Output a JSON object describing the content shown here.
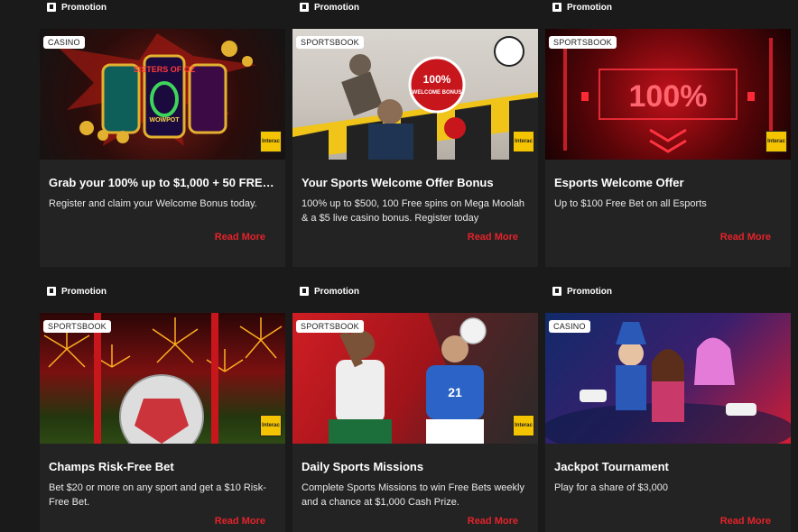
{
  "promo_label": "Promotion",
  "read_more": "Read More",
  "interac_label": "Interac",
  "cards": [
    {
      "tag": "CASINO",
      "title": "Grab your 100% up to $1,000 + 50 FREE ...",
      "desc": "Register and claim your Welcome Bonus today."
    },
    {
      "tag": "SPORTSBOOK",
      "title": "Your Sports Welcome Offer Bonus",
      "desc": "100% up to $500, 100 Free spins on Mega Moolah & a $5 live casino bonus. Register today"
    },
    {
      "tag": "SPORTSBOOK",
      "title": "Esports Welcome Offer",
      "desc": "Up to $100 Free Bet on all Esports"
    },
    {
      "tag": "SPORTSBOOK",
      "title": "Champs Risk-Free Bet",
      "desc": "Bet $20 or more on any sport and get a $10 Risk-Free Bet."
    },
    {
      "tag": "SPORTSBOOK",
      "title": "Daily Sports Missions",
      "desc": "Complete Sports Missions to win Free Bets weekly and a chance at $1,000 Cash Prize."
    },
    {
      "tag": "CASINO",
      "title": "Jackpot Tournament",
      "desc": "Play for a share of $3,000"
    }
  ],
  "image_text": {
    "slot_1": "SISTERS OF OZ",
    "slot_2": "WOWPOT",
    "badge_100": "100%",
    "welcome_bonus": "WELCOME BONUS",
    "esports_big": "100%",
    "jersey_number": "21"
  },
  "colors": {
    "accent": "#e4232a",
    "card_bg": "#232323",
    "page_bg": "#1a1a1a",
    "interac": "#f5c400"
  }
}
